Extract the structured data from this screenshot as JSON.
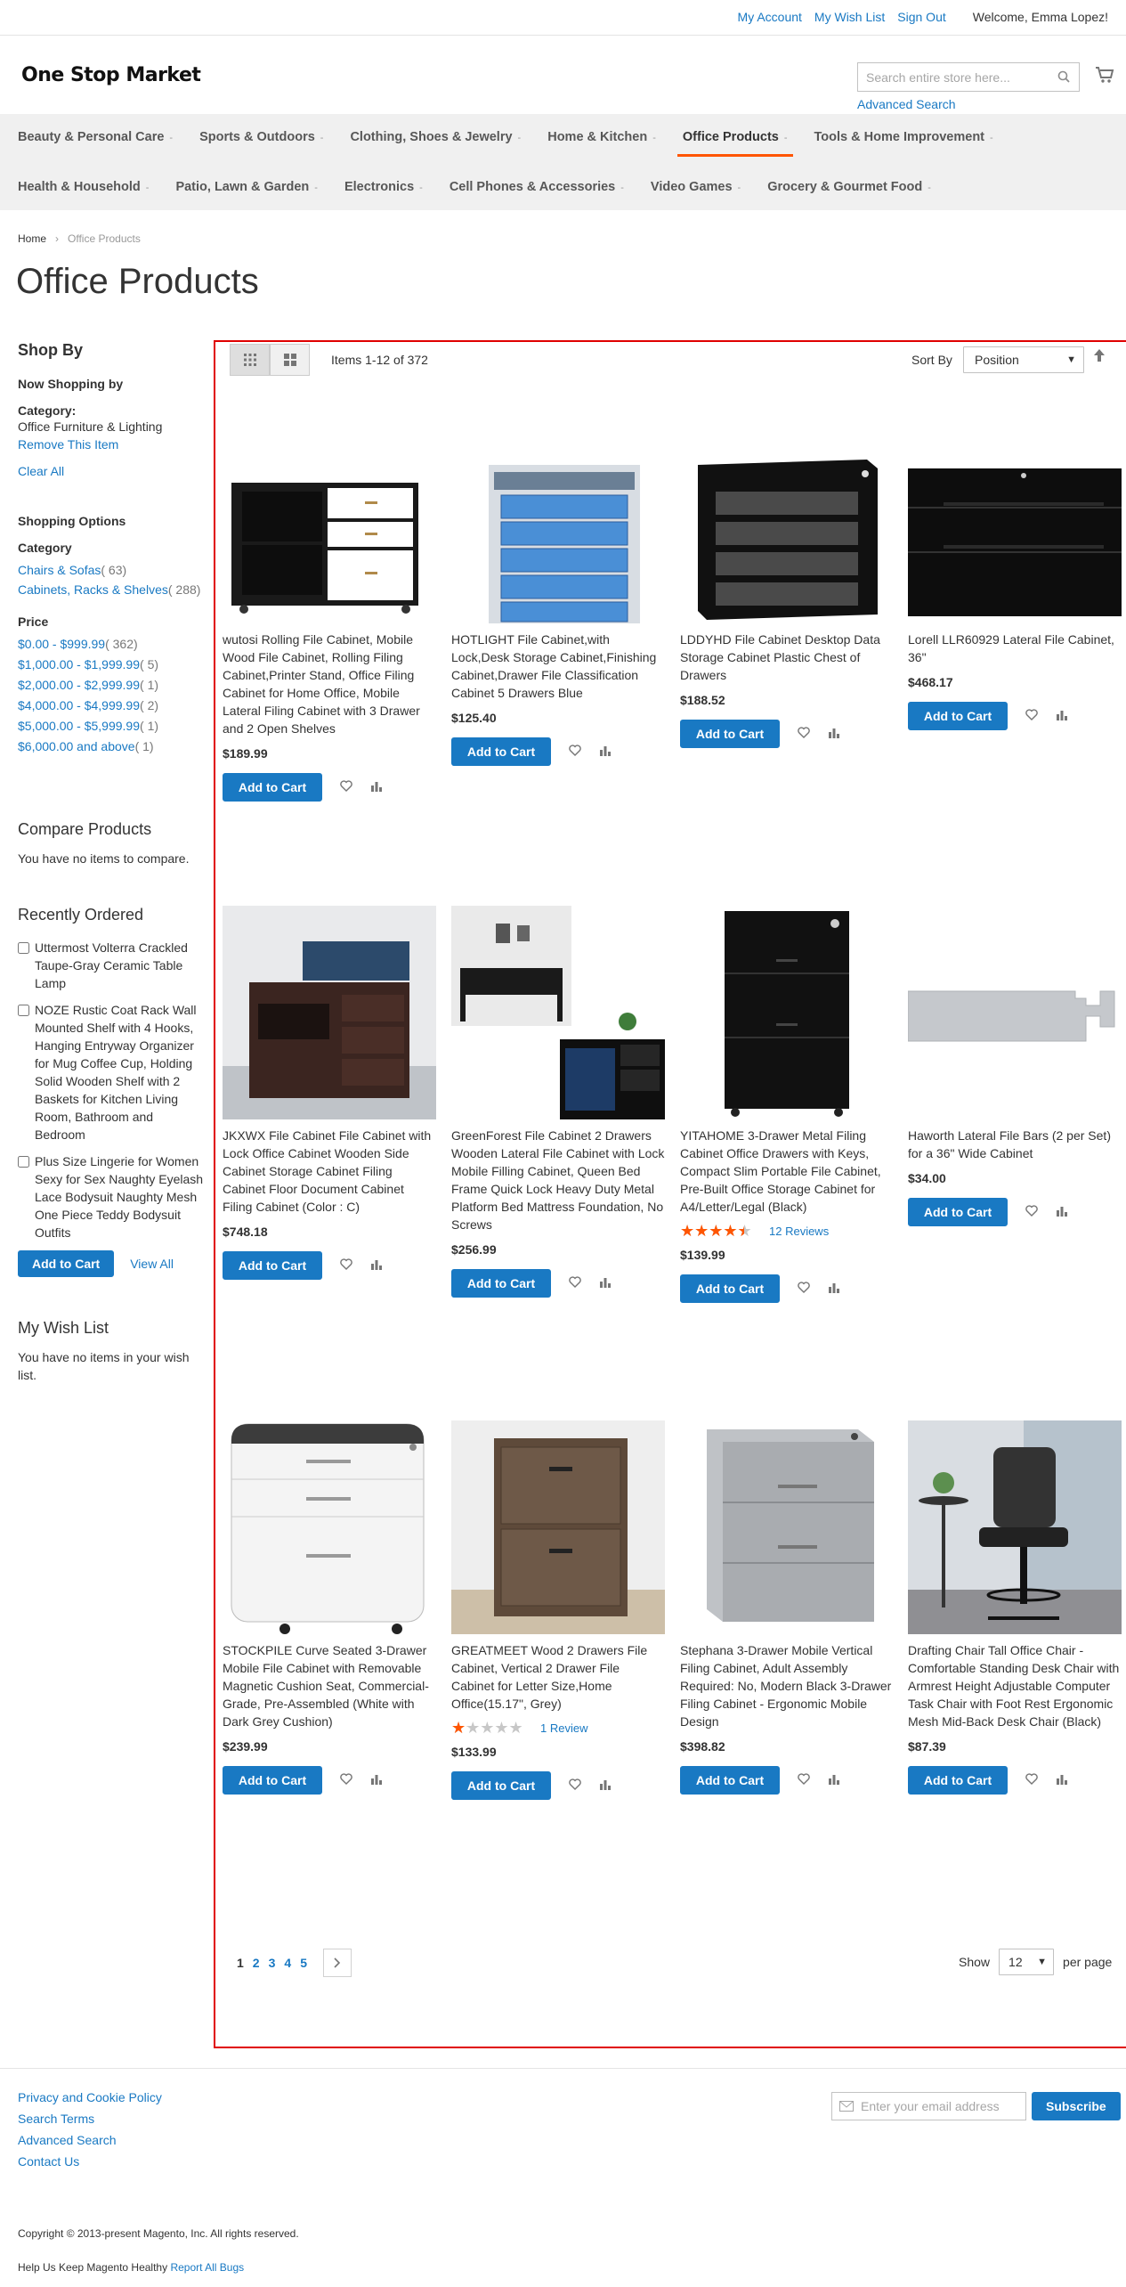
{
  "header": {
    "links": [
      "My Account",
      "My Wish List",
      "Sign Out"
    ],
    "welcome": "Welcome, Emma Lopez!",
    "logo": "One Stop Market",
    "search_placeholder": "Search entire store here...",
    "advanced_search": "Advanced Search"
  },
  "nav": {
    "row1": [
      "Beauty & Personal Care",
      "Sports & Outdoors",
      "Clothing, Shoes & Jewelry",
      "Home & Kitchen",
      "Office Products",
      "Tools & Home Improvement"
    ],
    "row2": [
      "Health & Household",
      "Patio, Lawn & Garden",
      "Electronics",
      "Cell Phones & Accessories",
      "Video Games",
      "Grocery & Gourmet Food"
    ],
    "active": "Office Products"
  },
  "breadcrumb": {
    "home": "Home",
    "current": "Office Products"
  },
  "page_title": "Office Products",
  "sidebar": {
    "shop_by": "Shop By",
    "now_shopping_by": "Now Shopping by",
    "category_label": "Category:",
    "category_value": "Office Furniture & Lighting",
    "remove_item": "Remove This Item",
    "clear_all": "Clear All",
    "shopping_options": "Shopping Options",
    "category_heading": "Category",
    "categories": [
      {
        "label": "Chairs & Sofas",
        "count": "( 63)"
      },
      {
        "label": "Cabinets, Racks & Shelves",
        "count": "( 288)"
      }
    ],
    "price_heading": "Price",
    "prices": [
      {
        "label": "$0.00 - $999.99",
        "count": "( 362)"
      },
      {
        "label": "$1,000.00 - $1,999.99",
        "count": "( 5)"
      },
      {
        "label": "$2,000.00 - $2,999.99",
        "count": "( 1)"
      },
      {
        "label": "$4,000.00 - $4,999.99",
        "count": "( 2)"
      },
      {
        "label": "$5,000.00 - $5,999.99",
        "count": "( 1)"
      },
      {
        "label": "$6,000.00 and above",
        "count": "( 1)"
      }
    ],
    "compare_heading": "Compare Products",
    "compare_empty": "You have no items to compare.",
    "recent_heading": "Recently Ordered",
    "recent_items": [
      "Uttermost Volterra Crackled Taupe-Gray Ceramic Table Lamp",
      "NOZE Rustic Coat Rack Wall Mounted Shelf with 4 Hooks, Hanging Entryway Organizer for Mug Coffee Cup, Holding Solid Wooden Shelf with 2 Baskets for Kitchen Living Room, Bathroom and Bedroom",
      "Plus Size Lingerie for Women Sexy for Sex Naughty Eyelash Lace Bodysuit Naughty Mesh One Piece Teddy Bodysuit Outfits"
    ],
    "add_to_cart": "Add to Cart",
    "view_all": "View All",
    "wishlist_heading": "My Wish List",
    "wishlist_empty": "You have no items in your wish list."
  },
  "toolbar": {
    "amount": "Items 1-12 of 372",
    "sort_by_label": "Sort By",
    "sort_by_value": "Position"
  },
  "products": [
    {
      "name": "wutosi Rolling File Cabinet, Mobile Wood File Cabinet, Rolling Filing Cabinet,Printer Stand, Office Filing Cabinet for Home Office, Mobile Lateral Filing Cabinet with 3 Drawer and 2 Open Shelves",
      "price": "$189.99"
    },
    {
      "name": "HOTLIGHT File Cabinet,with Lock,Desk Storage Cabinet,Finishing Cabinet,Drawer File Classification Cabinet 5 Drawers Blue",
      "price": "$125.40"
    },
    {
      "name": "LDDYHD File Cabinet Desktop Data Storage Cabinet Plastic Chest of Drawers",
      "price": "$188.52"
    },
    {
      "name": "Lorell LLR60929 Lateral File Cabinet, 36\"",
      "price": "$468.17"
    },
    {
      "name": "JKXWX File Cabinet File Cabinet with Lock Office Cabinet Wooden Side Cabinet Storage Cabinet Filing Cabinet Floor Document Cabinet Filing Cabinet (Color : C)",
      "price": "$748.18"
    },
    {
      "name": "GreenForest File Cabinet 2 Drawers Wooden Lateral File Cabinet with Lock Mobile Filling Cabinet, Queen Bed Frame Quick Lock Heavy Duty Metal Platform Bed Mattress Foundation, No Screws",
      "price": "$256.99"
    },
    {
      "name": "YITAHOME 3-Drawer Metal Filing Cabinet Office Drawers with Keys, Compact Slim Portable File Cabinet, Pre-Built Office Storage Cabinet for A4/Letter/Legal (Black)",
      "price": "$139.99",
      "rating": 0.8,
      "reviews": "12  Reviews"
    },
    {
      "name": "Haworth Lateral File Bars (2 per Set) for a 36\" Wide Cabinet",
      "price": "$34.00"
    },
    {
      "name": "STOCKPILE Curve Seated 3-Drawer Mobile File Cabinet with Removable Magnetic Cushion Seat, Commercial-Grade, Pre-Assembled (White with Dark Grey Cushion)",
      "price": "$239.99"
    },
    {
      "name": "GREATMEET Wood 2 Drawers File Cabinet, Vertical 2 Drawer File Cabinet for Letter Size,Home Office(15.17\", Grey)",
      "price": "$133.99",
      "rating": 0.2,
      "reviews": "1  Review"
    },
    {
      "name": "Stephana 3-Drawer Mobile Vertical Filing Cabinet, Adult Assembly Required: No, Modern Black 3-Drawer Filing Cabinet - Ergonomic Mobile Design",
      "price": "$398.82"
    },
    {
      "name": "Drafting Chair Tall Office Chair - Comfortable Standing Desk Chair with Armrest Height Adjustable Computer Task Chair with Foot Rest Ergonomic Mesh Mid-Back Desk Chair (Black)",
      "price": "$87.39"
    }
  ],
  "product_button": "Add to Cart",
  "pager": {
    "pages": [
      "1",
      "2",
      "3",
      "4",
      "5"
    ],
    "current": "1",
    "show": "Show",
    "limit": "12",
    "per_page": "per page"
  },
  "footer": {
    "links": [
      "Privacy and Cookie Policy",
      "Search Terms",
      "Advanced Search",
      "Contact Us"
    ],
    "email_placeholder": "Enter your email address",
    "subscribe": "Subscribe",
    "copyright": "Copyright © 2013-present Magento, Inc. All rights reserved.",
    "bugs_text": "Help Us Keep Magento Healthy",
    "bugs_link": "Report All Bugs"
  },
  "colors": {
    "link": "#1979c3",
    "accent": "#ff5501",
    "highlight_border": "#e00000"
  }
}
